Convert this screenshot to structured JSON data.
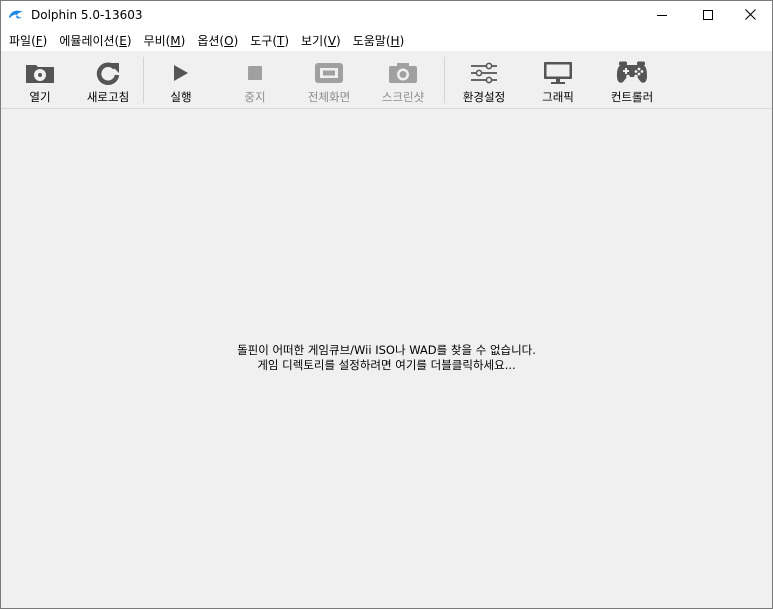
{
  "window": {
    "title": "Dolphin 5.0-13603"
  },
  "menu": [
    {
      "label": "파일(",
      "key": "F",
      "tail": ")"
    },
    {
      "label": "에뮬레이션(",
      "key": "E",
      "tail": ")"
    },
    {
      "label": "무비(",
      "key": "M",
      "tail": ")"
    },
    {
      "label": "옵션(",
      "key": "O",
      "tail": ")"
    },
    {
      "label": "도구(",
      "key": "T",
      "tail": ")"
    },
    {
      "label": "보기(",
      "key": "V",
      "tail": ")"
    },
    {
      "label": "도움말(",
      "key": "H",
      "tail": ")"
    }
  ],
  "toolbar": {
    "open": "열기",
    "refresh": "새로고침",
    "play": "실행",
    "stop": "중지",
    "fullscreen": "전체화면",
    "screenshot": "스크린샷",
    "config": "환경설정",
    "graphics": "그래픽",
    "controllers": "컨트롤러"
  },
  "content": {
    "empty_line1": "돌핀이 어떠한 게임큐브/Wii ISO나 WAD를 찾을 수 없습니다.",
    "empty_line2": "게임 디렉토리를 설정하려면 여기를 더블클릭하세요..."
  },
  "colors": {
    "toolbar_bg": "#f0f0f0",
    "icon_dark": "#555555",
    "icon_disabled": "#a0a0a0",
    "dolphin_blue": "#1e88e5"
  }
}
